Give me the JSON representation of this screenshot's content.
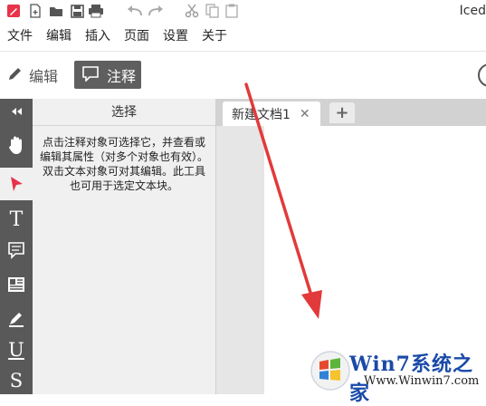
{
  "app": {
    "title_fragment": "Iced"
  },
  "menu": {
    "items": [
      "文件",
      "编辑",
      "插入",
      "页面",
      "设置",
      "关于"
    ]
  },
  "modes": {
    "edit_label": "编辑",
    "annotate_label": "注释"
  },
  "panel": {
    "title": "选择",
    "description": "点击注释对象可选择它，并查看或编辑其属性（对多个对象也有效）。双击文本对象可对其编辑。此工具也可用于选定文本块。"
  },
  "tabs": [
    {
      "label": "新建文档1",
      "close": "✕"
    }
  ],
  "tab_add_label": "+",
  "tools": [
    {
      "name": "collapse-panel",
      "glyph": "◂◂"
    },
    {
      "name": "hand-tool",
      "glyph": "✋"
    },
    {
      "name": "select-tool",
      "glyph": "➤"
    },
    {
      "name": "text-tool",
      "glyph": "T"
    },
    {
      "name": "comment-tool",
      "glyph": "▭"
    },
    {
      "name": "textbox-tool",
      "glyph": "▤"
    },
    {
      "name": "highlight-tool",
      "glyph": "✎"
    },
    {
      "name": "underline-tool",
      "glyph": "U"
    },
    {
      "name": "strikethrough-tool",
      "glyph": "S"
    }
  ],
  "watermark": {
    "title": "Win7系统之家",
    "url": "Www.Winwin7.com"
  },
  "colors": {
    "accent": "#e8324a",
    "toolbar_dark": "#595959",
    "annotation_arrow": "#e23a3a"
  }
}
